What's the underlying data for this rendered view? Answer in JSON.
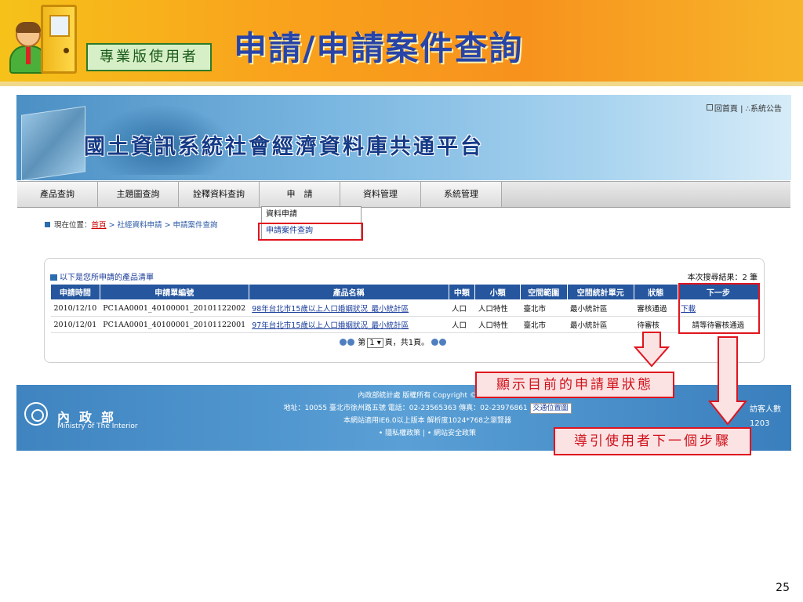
{
  "slide": {
    "badge": "專業版使用者",
    "title": "申請/申請案件查詢",
    "page_number": "25"
  },
  "site": {
    "title": "國土資訊系統社會經濟資料庫共通平台",
    "top_links": {
      "home": "回首頁",
      "separator": "|",
      "notice": "系統公告"
    }
  },
  "nav": {
    "items": [
      "產品查詢",
      "主題圖查詢",
      "詮釋資料查詢",
      "申　請",
      "資料管理",
      "系統管理"
    ],
    "dropdown": [
      "資料申請",
      "申請案件查詢"
    ]
  },
  "breadcrumb": {
    "label": "現在位置：",
    "home": "首頁",
    "sep": " > ",
    "level1": "社經資料申請",
    "current": "申請案件查詢"
  },
  "results": {
    "heading": "以下是您所申請的產品清單",
    "count": "本次搜尋結果：2 筆",
    "columns": [
      "申請時間",
      "申請單編號",
      "產品名稱",
      "中類",
      "小類",
      "空間範圍",
      "空間統計單元",
      "狀態",
      "下一步"
    ],
    "rows": [
      [
        "2010/12/10",
        "PC1AA0001_40100001_20101122002",
        "98年台北市15歲以上人口婚姻狀況_最小統計區",
        "人口",
        "人口特性",
        "臺北市",
        "最小統計區",
        "審核通過",
        "下載"
      ],
      [
        "2010/12/01",
        "PC1AA0001_40100001_20101122001",
        "97年台北市15歲以上人口婚姻狀況_最小統計區",
        "人口",
        "人口特性",
        "臺北市",
        "最小統計區",
        "待審核",
        "請等待審核通過"
      ]
    ],
    "pager": {
      "prefix": "第",
      "page": "1",
      "suffix": "頁，共1頁。"
    }
  },
  "footer": {
    "ministry_zh": "內政部",
    "ministry_en": "Ministry of The Interior",
    "line1": "內政部統計處 版權所有 Copyright © 2010",
    "line2": "地址：10055 臺北市徐州路五號 電話：02-23565363 傳真：02-23976861",
    "map_button": "交通位置圖",
    "line3": "本網站適用IE6.0以上版本 解析度1024*768之瀏覽器",
    "privacy": "隱私權政策",
    "security": "網站安全政策",
    "visitors_label": "訪客人數",
    "visitors_value": "1203"
  },
  "callouts": {
    "status": "顯示目前的申請單狀態",
    "next_step": "導引使用者下一個步驟"
  },
  "colors": {
    "highlight_red": "#e0141e",
    "header_blue": "#25569e",
    "banner_orange": "#f7921d"
  }
}
